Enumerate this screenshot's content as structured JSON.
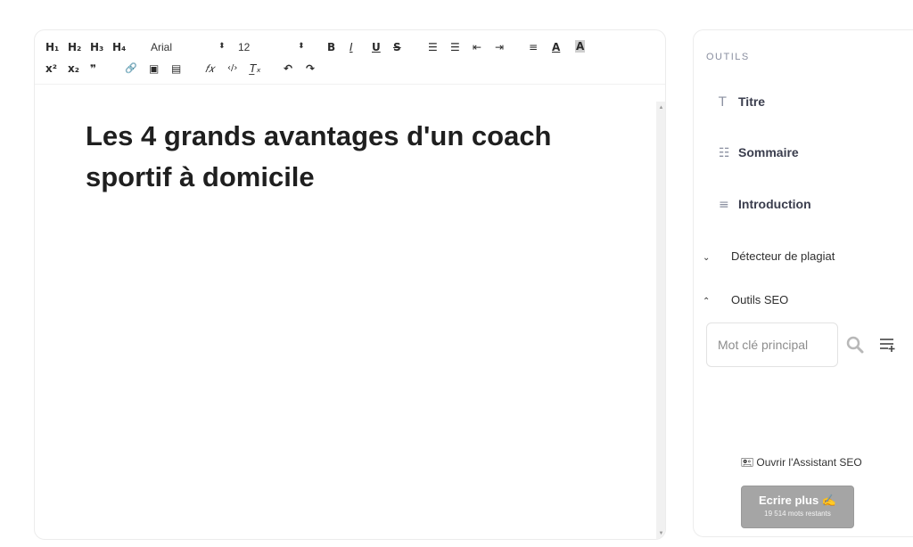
{
  "toolbar": {
    "h1": "H₁",
    "h2": "H₂",
    "h3": "H₃",
    "h4": "H₄",
    "font_family": "Arial",
    "font_size": "12",
    "select_arrow": "⬍",
    "bold": "B",
    "italic": "I",
    "underline": "U",
    "strike": "S",
    "ordered_list": "☰",
    "bullet_list": "☰",
    "outdent": "⇤",
    "indent": "⇥",
    "align": "≡",
    "text_color": "A",
    "highlight": "A",
    "superscript": "x²",
    "subscript": "x₂",
    "quote": "❞",
    "link": "🔗",
    "image": "▣",
    "video": "▤",
    "formula": "𝑓𝑥",
    "code": "‹/›",
    "clear_format": "T̲ₓ",
    "undo": "↶",
    "redo": "↷"
  },
  "document": {
    "title": "Les 4 grands avantages d'un coach sportif à domicile"
  },
  "sidebar": {
    "heading": "OUTILS",
    "tools": [
      {
        "icon": "T",
        "label": "Titre"
      },
      {
        "icon": "☷",
        "label": "Sommaire"
      },
      {
        "icon": "≡",
        "label": "Introduction"
      }
    ],
    "plagiarism_label": "Détecteur de plagiat",
    "plagiarism_chevron": "⌄",
    "seo_label": "Outils SEO",
    "seo_chevron": "⌃",
    "keyword_placeholder": "Mot clé principal",
    "assistant_label": "🖭 Ouvrir l'Assistant SEO",
    "write_label": "Ecrire plus ✍",
    "write_sub": "19 514 mots restants"
  }
}
